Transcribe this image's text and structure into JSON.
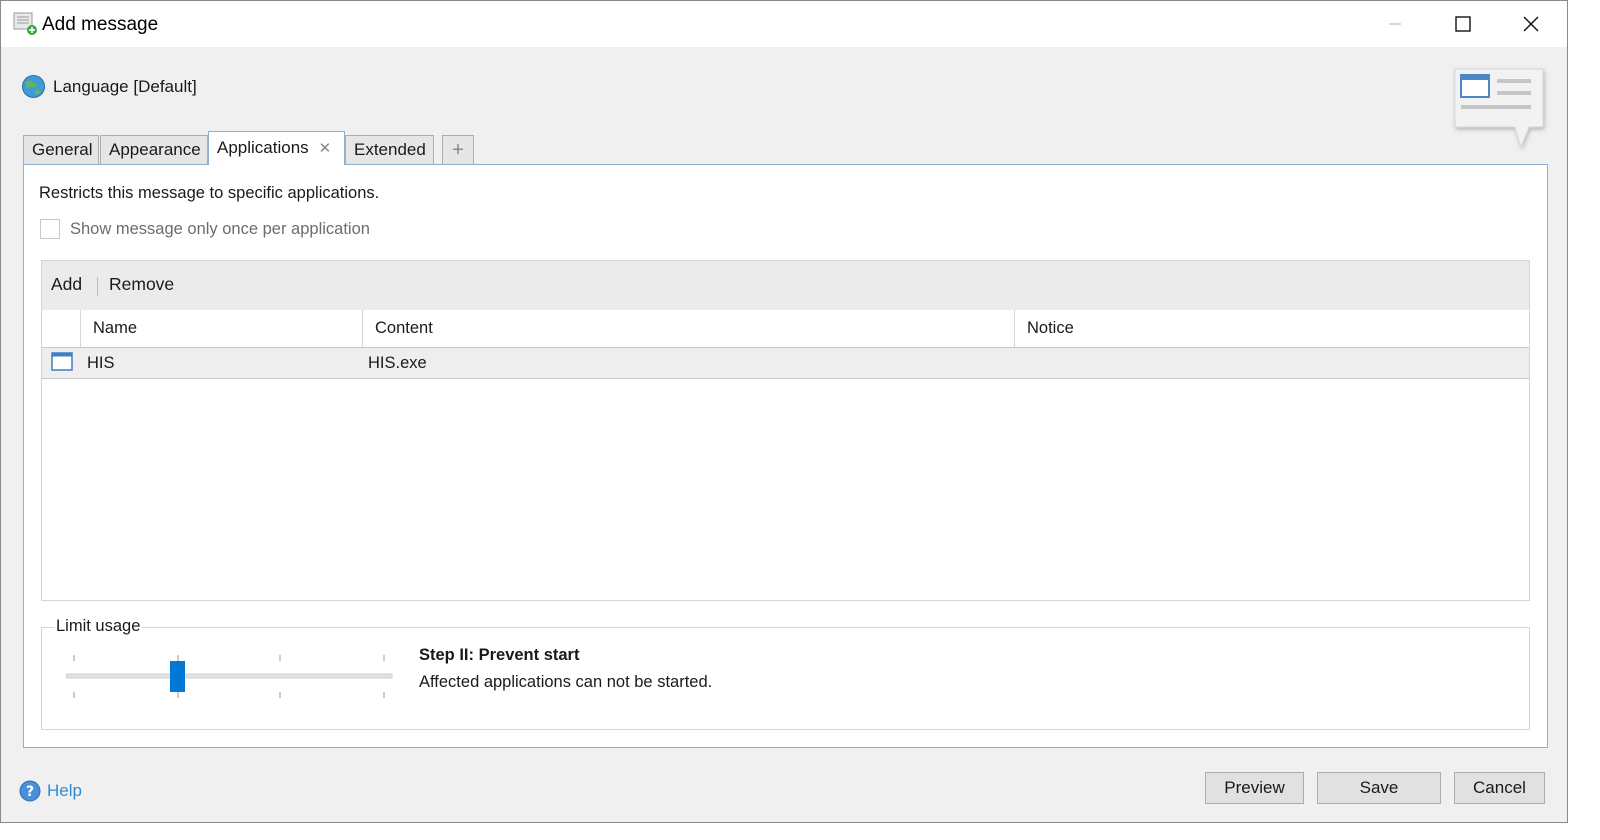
{
  "window": {
    "title": "Add message"
  },
  "language": {
    "label": "Language [Default]"
  },
  "tabs": [
    {
      "label": "General",
      "active": false
    },
    {
      "label": "Appearance",
      "active": false
    },
    {
      "label": "Applications",
      "active": true,
      "closable": true
    },
    {
      "label": "Extended",
      "active": false
    }
  ],
  "tab_add_icon": "plus-icon",
  "applications": {
    "description": "Restricts this message to specific applications.",
    "show_once_label": "Show message only once per application",
    "show_once_checked": false,
    "toolbar": {
      "add_label": "Add",
      "remove_label": "Remove"
    },
    "columns": [
      "Name",
      "Content",
      "Notice"
    ],
    "rows": [
      {
        "icon": "window-icon",
        "name": "HIS",
        "content": "HIS.exe",
        "notice": ""
      }
    ]
  },
  "limit_usage": {
    "legend": "Limit usage",
    "slider_steps": 4,
    "slider_value_index": 1,
    "step_title": "Step II: Prevent start",
    "step_description": "Affected applications can not be started."
  },
  "footer": {
    "help_label": "Help",
    "preview_label": "Preview",
    "save_label": "Save",
    "cancel_label": "Cancel"
  },
  "colors": {
    "accent": "#0078d7",
    "link": "#2f8ad6",
    "panel_border": "#8fb0d0"
  }
}
